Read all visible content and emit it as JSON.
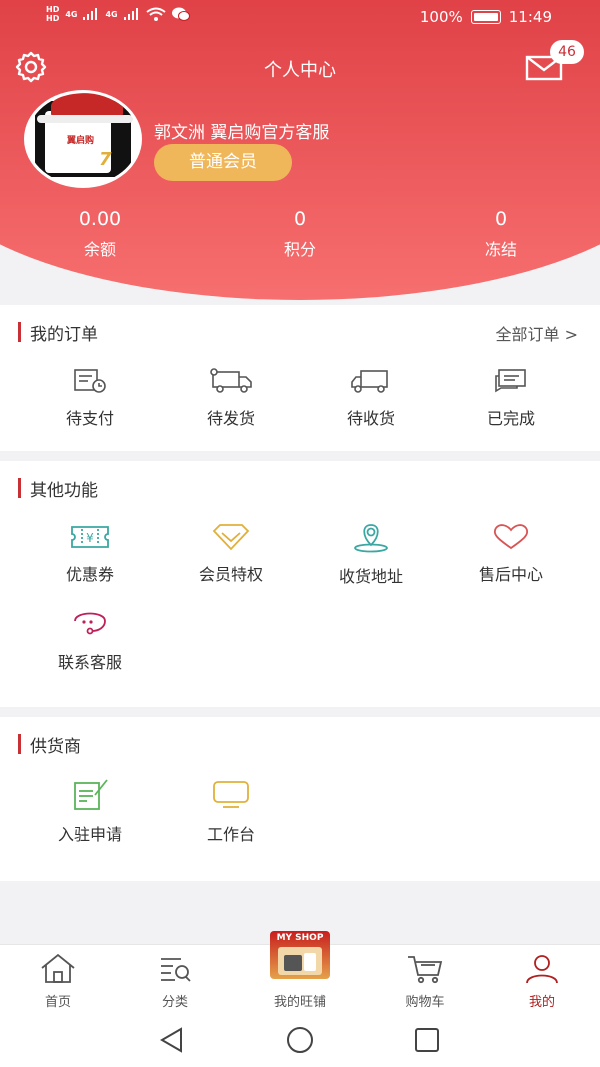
{
  "status_bar": {
    "hd1": "HD",
    "hd2": "HD",
    "sig1": "4G",
    "sig2": "4G",
    "battery": "100%",
    "time": "11:49"
  },
  "header": {
    "title": "个人中心",
    "mail_count": "46",
    "username": "郭文洲 翼启购官方客服",
    "member_level": "普通会员",
    "avatar_brand": "翼启购",
    "avatar_num": "7"
  },
  "stats": [
    {
      "value": "0.00",
      "label": "余额"
    },
    {
      "value": "0",
      "label": "积分"
    },
    {
      "value": "0",
      "label": "冻结"
    }
  ],
  "orders": {
    "title": "我的订单",
    "all_label": "全部订单 >",
    "items": [
      {
        "label": "待支付",
        "icon": "bill-clock-icon"
      },
      {
        "label": "待发货",
        "icon": "truck-icon"
      },
      {
        "label": "待收货",
        "icon": "delivery-truck-icon"
      },
      {
        "label": "已完成",
        "icon": "chat-check-icon"
      }
    ]
  },
  "other": {
    "title": "其他功能",
    "items": [
      {
        "label": "优惠券",
        "icon": "coupon-icon"
      },
      {
        "label": "会员特权",
        "icon": "diamond-icon"
      },
      {
        "label": "收货地址",
        "icon": "location-icon"
      },
      {
        "label": "售后中心",
        "icon": "heart-icon"
      },
      {
        "label": "联系客服",
        "icon": "headset-icon"
      }
    ]
  },
  "supplier": {
    "title": "供货商",
    "items": [
      {
        "label": "入驻申请",
        "icon": "edit-form-icon"
      },
      {
        "label": "工作台",
        "icon": "monitor-icon"
      }
    ]
  },
  "tabbar": {
    "items": [
      {
        "label": "首页",
        "icon": "home-icon"
      },
      {
        "label": "分类",
        "icon": "category-search-icon"
      },
      {
        "label": "我的旺铺",
        "icon": "my-shop-icon"
      },
      {
        "label": "购物车",
        "icon": "cart-icon"
      },
      {
        "label": "我的",
        "icon": "user-icon"
      }
    ],
    "shop_badge": "MY SHOP",
    "active_index": 4
  },
  "colors": {
    "brand_red": "#c93036",
    "gold": "#f0b65a",
    "teal": "#3aa7a2",
    "active_tab": "#b02020"
  }
}
